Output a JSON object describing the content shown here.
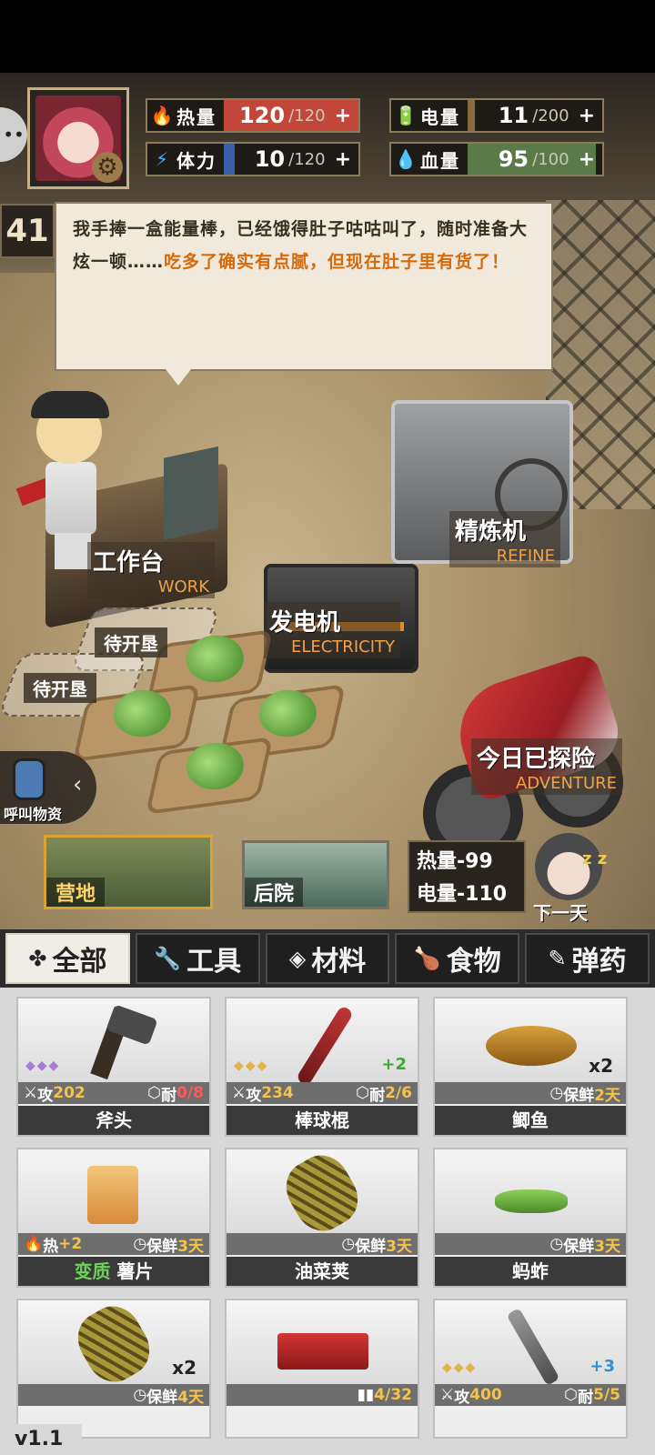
{
  "stats": {
    "heat": {
      "label": "热量",
      "value": "120",
      "max": "/120",
      "plus": "+",
      "fill": 1.0,
      "color": "#c2473a"
    },
    "stamina": {
      "label": "体力",
      "value": "10",
      "max": "/120",
      "plus": "+",
      "fill": 0.083,
      "color": "#3a5fa8"
    },
    "power": {
      "label": "电量",
      "value": "11",
      "max": "/200",
      "plus": "+",
      "fill": 0.055,
      "color": "#8a6a3a"
    },
    "health": {
      "label": "血量",
      "value": "95",
      "max": "/100",
      "plus": "+",
      "fill": 0.95,
      "color": "#5a7a4a"
    }
  },
  "day": "41",
  "dialogue": {
    "normal": "我手捧一盒能量棒，已经饿得肚子咕咕叫了，随时准备大炫一顿……",
    "highlight": "吃多了确实有点腻，但现在肚子里有货了！"
  },
  "stations": {
    "work": {
      "cn": "工作台",
      "en": "WORK"
    },
    "refine": {
      "cn": "精炼机",
      "en": "REFINE"
    },
    "electricity": {
      "cn": "发电机",
      "en": "ELECTRICITY"
    },
    "adventure": {
      "cn": "今日已探险",
      "en": "ADVENTURE"
    }
  },
  "farm": {
    "pending1": "待开垦",
    "pending2": "待开垦"
  },
  "call_supplies": "呼叫物资",
  "locations": {
    "camp": "营地",
    "backyard": "后院"
  },
  "cost": {
    "heat": "热量-99",
    "power": "电量-110"
  },
  "next_day": "下一天",
  "categories": [
    {
      "label": "全部",
      "icon": "✤"
    },
    {
      "label": "工具",
      "icon": "🔧"
    },
    {
      "label": "材料",
      "icon": "◈"
    },
    {
      "label": "食物",
      "icon": "🍗"
    },
    {
      "label": "弹药",
      "icon": "✎"
    }
  ],
  "items": [
    {
      "name": "斧头",
      "left_label": "攻",
      "left_value": "202",
      "right_label": "耐",
      "right_value": "0/8",
      "gems": "◆◆◆",
      "plus": "",
      "qty": ""
    },
    {
      "name": "棒球棍",
      "left_label": "攻",
      "left_value": "234",
      "right_label": "耐",
      "right_value": "2/6",
      "gems": "◆◆◆",
      "plus": "+2",
      "qty": ""
    },
    {
      "name": "鲫鱼",
      "left_label": "",
      "left_value": "",
      "right_label": "保鲜",
      "right_value": "2天",
      "gems": "",
      "plus": "",
      "qty": "x2"
    },
    {
      "name_prefix": "变质",
      "name": "薯片",
      "left_label": "热",
      "left_value": "+2",
      "right_label": "保鲜",
      "right_value": "3天",
      "gems": "",
      "plus": "",
      "qty": ""
    },
    {
      "name": "油菜荚",
      "left_label": "",
      "left_value": "",
      "right_label": "保鲜",
      "right_value": "3天",
      "gems": "",
      "plus": "",
      "qty": ""
    },
    {
      "name": "蚂蚱",
      "left_label": "",
      "left_value": "",
      "right_label": "保鲜",
      "right_value": "3天",
      "gems": "",
      "plus": "",
      "qty": ""
    },
    {
      "name": "",
      "left_label": "",
      "left_value": "",
      "right_label": "保鲜",
      "right_value": "4天",
      "gems": "",
      "plus": "",
      "qty": "x2"
    },
    {
      "name": "",
      "left_label": "",
      "left_value": "",
      "right_label": "",
      "right_value": "4/32",
      "gems": "",
      "plus": "",
      "qty": ""
    },
    {
      "name": "",
      "left_label": "攻",
      "left_value": "400",
      "right_label": "耐",
      "right_value": "5/5",
      "gems": "◆◆◆",
      "plus": "+3",
      "qty": ""
    }
  ],
  "version": "v1.1"
}
